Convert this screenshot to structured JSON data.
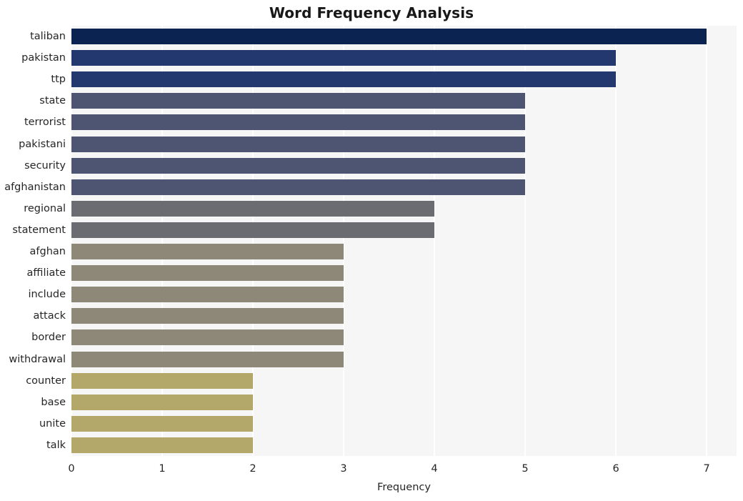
{
  "chart_data": {
    "type": "bar",
    "orientation": "horizontal",
    "title": "Word Frequency Analysis",
    "xlabel": "Frequency",
    "ylabel": "",
    "categories": [
      "taliban",
      "pakistan",
      "ttp",
      "state",
      "terrorist",
      "pakistani",
      "security",
      "afghanistan",
      "regional",
      "statement",
      "afghan",
      "affiliate",
      "include",
      "attack",
      "border",
      "withdrawal",
      "counter",
      "base",
      "unite",
      "talk"
    ],
    "values": [
      7,
      6,
      6,
      5,
      5,
      5,
      5,
      5,
      4,
      4,
      3,
      3,
      3,
      3,
      3,
      3,
      2,
      2,
      2,
      2
    ],
    "bar_colors": [
      "#0a2350",
      "#23386e",
      "#23386e",
      "#4d5572",
      "#4d5572",
      "#4d5572",
      "#4d5572",
      "#4d5572",
      "#6b6c72",
      "#6b6c72",
      "#8d8878",
      "#8d8878",
      "#8d8878",
      "#8d8878",
      "#8d8878",
      "#8d8878",
      "#b3a76a",
      "#b3a76a",
      "#b3a76a",
      "#b3a76a"
    ],
    "xlim": [
      0,
      7.33
    ],
    "xticks": [
      0,
      1,
      2,
      3,
      4,
      5,
      6,
      7
    ],
    "xtick_labels": [
      "0",
      "1",
      "2",
      "3",
      "4",
      "5",
      "6",
      "7"
    ],
    "grid": true,
    "grid_axis": "x",
    "grid_color": "#ffffff",
    "plot_background": "#f6f6f6",
    "figure_background": "#ffffff",
    "legend": null
  }
}
